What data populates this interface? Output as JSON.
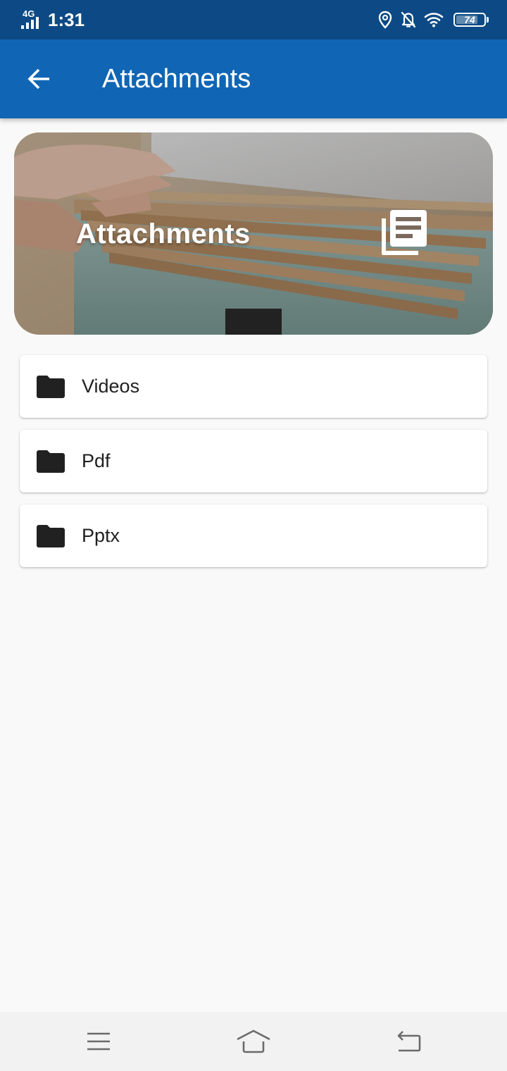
{
  "status_bar": {
    "network": "4G",
    "time": "1:31",
    "battery": "74"
  },
  "app_bar": {
    "title": "Attachments"
  },
  "banner": {
    "title": "Attachments"
  },
  "folders": [
    {
      "label": "Videos",
      "icon": "folder-icon"
    },
    {
      "label": "Pdf",
      "icon": "folder-icon"
    },
    {
      "label": "Pptx",
      "icon": "folder-icon"
    }
  ],
  "colors": {
    "status_bar": "#0d4a85",
    "app_bar": "#1066b4",
    "background": "#f9f9f9"
  }
}
